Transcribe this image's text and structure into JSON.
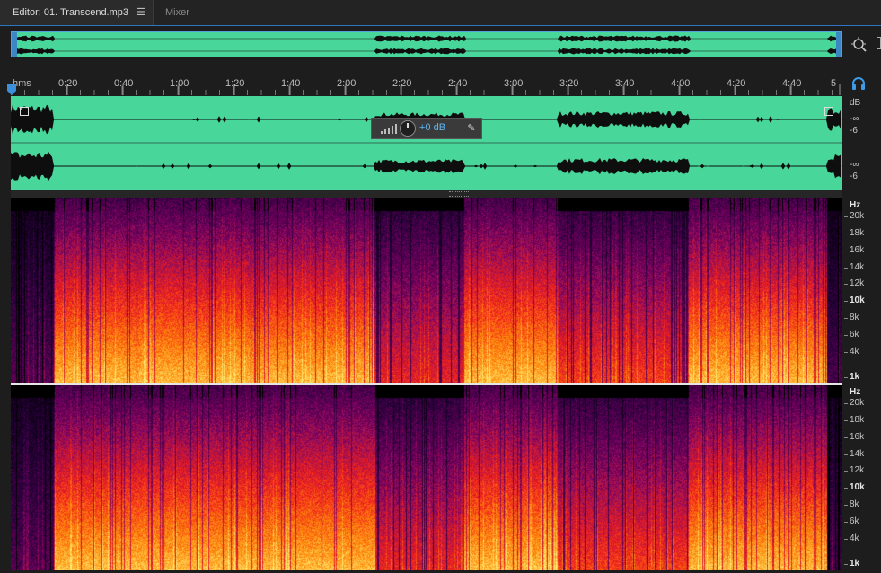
{
  "tabs": {
    "editor_label": "Editor: 01. Transcend.mp3",
    "menu_glyph": "☰",
    "mixer_label": "Mixer"
  },
  "ruler": {
    "unit": "hms",
    "ticks": [
      "0:20",
      "0:40",
      "1:00",
      "1:20",
      "1:40",
      "2:00",
      "2:20",
      "2:40",
      "3:00",
      "3:20",
      "3:40",
      "4:00",
      "4:20",
      "4:40",
      "5"
    ]
  },
  "hud": {
    "value": "+0 dB"
  },
  "db_scale": {
    "ch1": [
      "dB",
      "-∞",
      "-6"
    ],
    "ch2": [
      "-∞",
      "-6"
    ]
  },
  "freq_scale": [
    "Hz",
    "20k",
    "18k",
    "16k",
    "14k",
    "12k",
    "10k",
    "8k",
    "6k",
    "4k",
    "1k"
  ],
  "colors": {
    "waveform_bg": "#48d69a",
    "waveform": "#0e0e0e",
    "accent": "#2f74c0"
  },
  "icons": {
    "zoom": "zoom-navigator-icon",
    "headphones": "headphones-icon",
    "pin": "pin-icon",
    "playhead": "playhead-marker-icon"
  }
}
